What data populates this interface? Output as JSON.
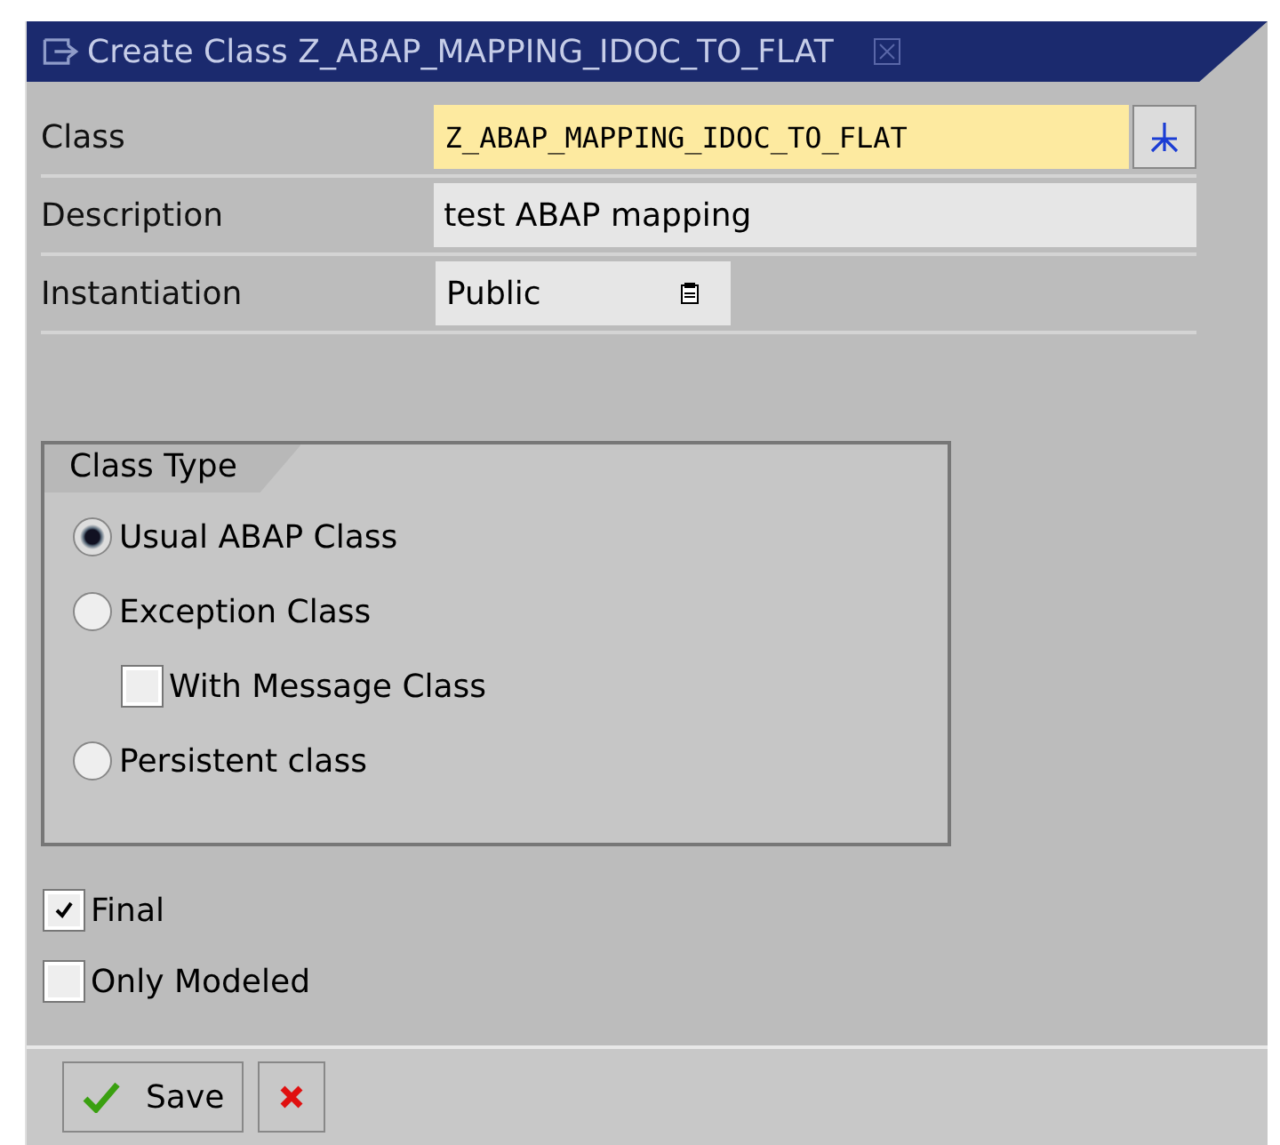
{
  "window": {
    "title": "Create Class Z_ABAP_MAPPING_IDOC_TO_FLAT"
  },
  "fields": [
    {
      "kind": "code",
      "label": "Class",
      "value": "Z_ABAP_MAPPING_IDOC_TO_FLAT"
    },
    {
      "kind": "text",
      "label": "Description",
      "value": "test ABAP mapping"
    },
    {
      "kind": "dropdown",
      "label": "Instantiation",
      "value": "Public"
    }
  ],
  "class_type": {
    "title": "Class Type",
    "options": [
      {
        "kind": "radio",
        "label": "Usual ABAP Class",
        "selected": true
      },
      {
        "kind": "radio",
        "label": "Exception Class",
        "selected": false
      },
      {
        "kind": "checkbox",
        "label": "With Message Class",
        "checked": false
      },
      {
        "kind": "radio",
        "label": "Persistent class",
        "selected": false
      }
    ]
  },
  "options": [
    {
      "label": "Final",
      "checked": true
    },
    {
      "label": "Only Modeled",
      "checked": false
    }
  ],
  "buttons": [
    {
      "kind": "save",
      "label": "Save"
    },
    {
      "kind": "cancel"
    }
  ]
}
